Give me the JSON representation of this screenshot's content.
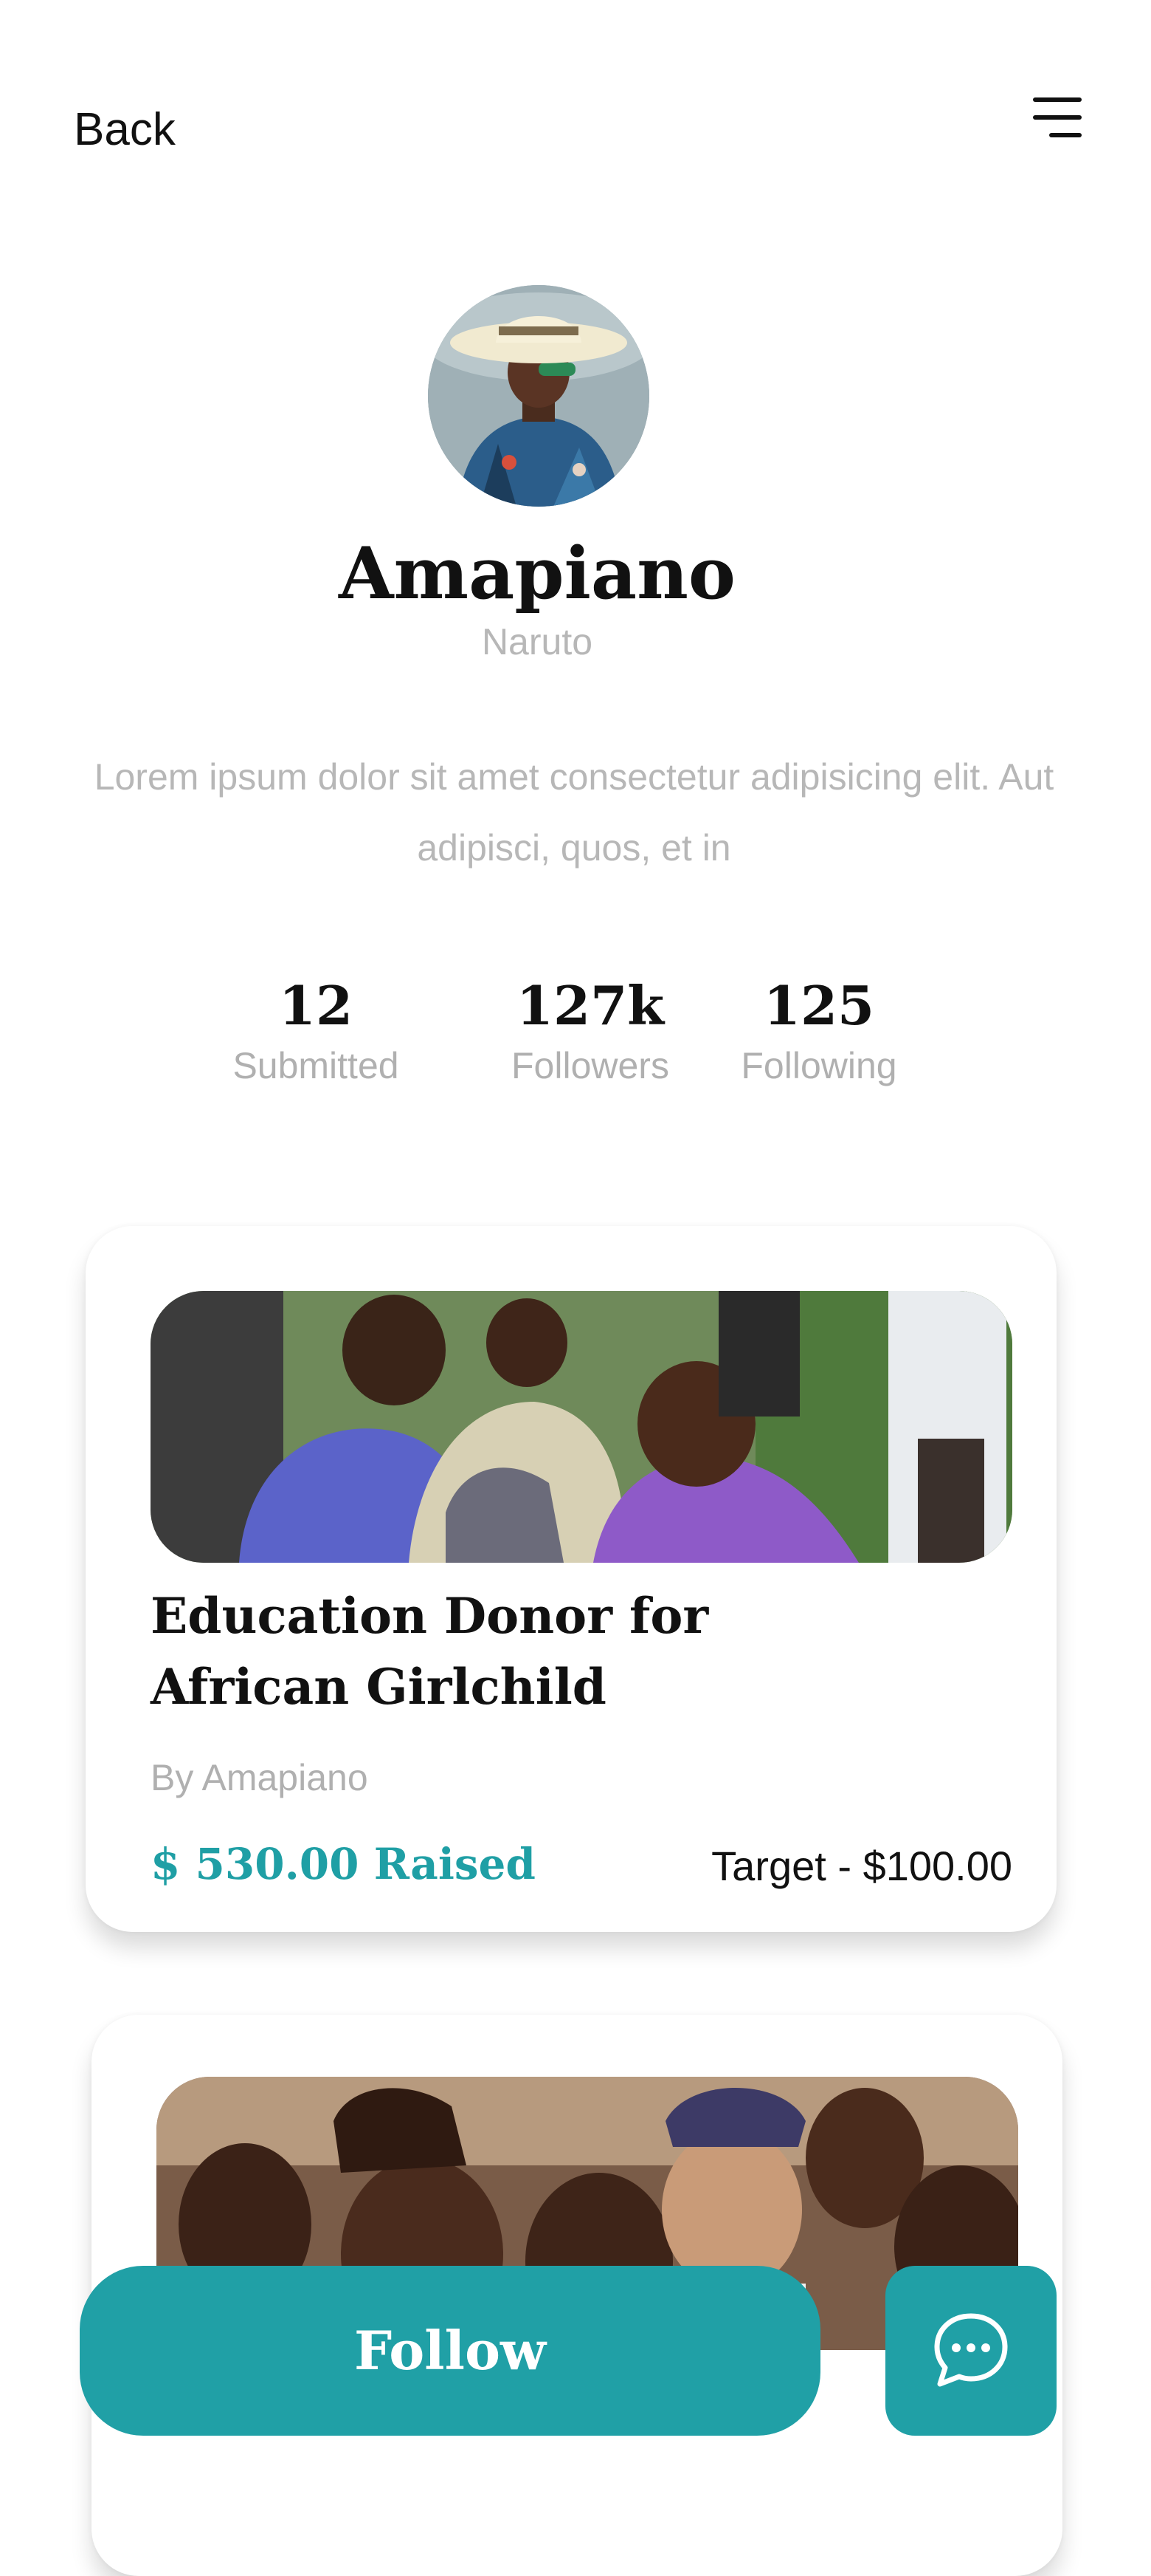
{
  "header": {
    "back_label": "Back",
    "menu_icon": "menu-icon"
  },
  "profile": {
    "name": "Amapiano",
    "handle": "Naruto",
    "bio": "Lorem ipsum dolor sit amet consectetur adipisicing elit. Aut adipisci, quos, et in"
  },
  "stats": [
    {
      "value": "12",
      "label": "Submitted"
    },
    {
      "value": "127k",
      "label": "Followers"
    },
    {
      "value": "125",
      "label": "Following"
    }
  ],
  "campaigns": [
    {
      "title": "Education Donor for African Girlchild",
      "author": "By Amapiano",
      "raised": "$ 530.00 Raised",
      "target": "Target - $100.00"
    }
  ],
  "actions": {
    "follow_label": "Follow",
    "chat_icon": "chat-bubble-icon"
  },
  "colors": {
    "accent": "#20a0a6",
    "muted_text": "#b0b0b0",
    "text": "#111111"
  }
}
